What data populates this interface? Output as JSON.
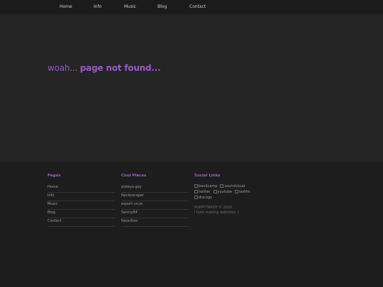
{
  "nav": {
    "items": [
      "Home",
      "Info",
      "Music",
      "Blog",
      "Contact"
    ]
  },
  "main": {
    "headline_light": "woah... ",
    "headline_bold": "page not found..."
  },
  "footer": {
    "pages": {
      "title": "Pages",
      "items": [
        "Home",
        "Info",
        "Music",
        "Blog",
        "Contact"
      ]
    },
    "cool_places": {
      "title": "Cool Places",
      "items": [
        "pokeyo.gay",
        "Neckoscaper",
        "export.vo.je",
        "Sentry64",
        "Neocities"
      ]
    },
    "social": {
      "title": "Social Links",
      "links": [
        "bandcamp",
        "soundcloud",
        "twitter",
        "youtube",
        "lastfm",
        "discogs"
      ],
      "copyright": "PUPPYTRASH © 2020",
      "tagline": "i hate making websites :)"
    }
  },
  "colors": {
    "accent": "#9b59c8",
    "background": "#222222",
    "footer_bg": "#1d1d1d"
  }
}
